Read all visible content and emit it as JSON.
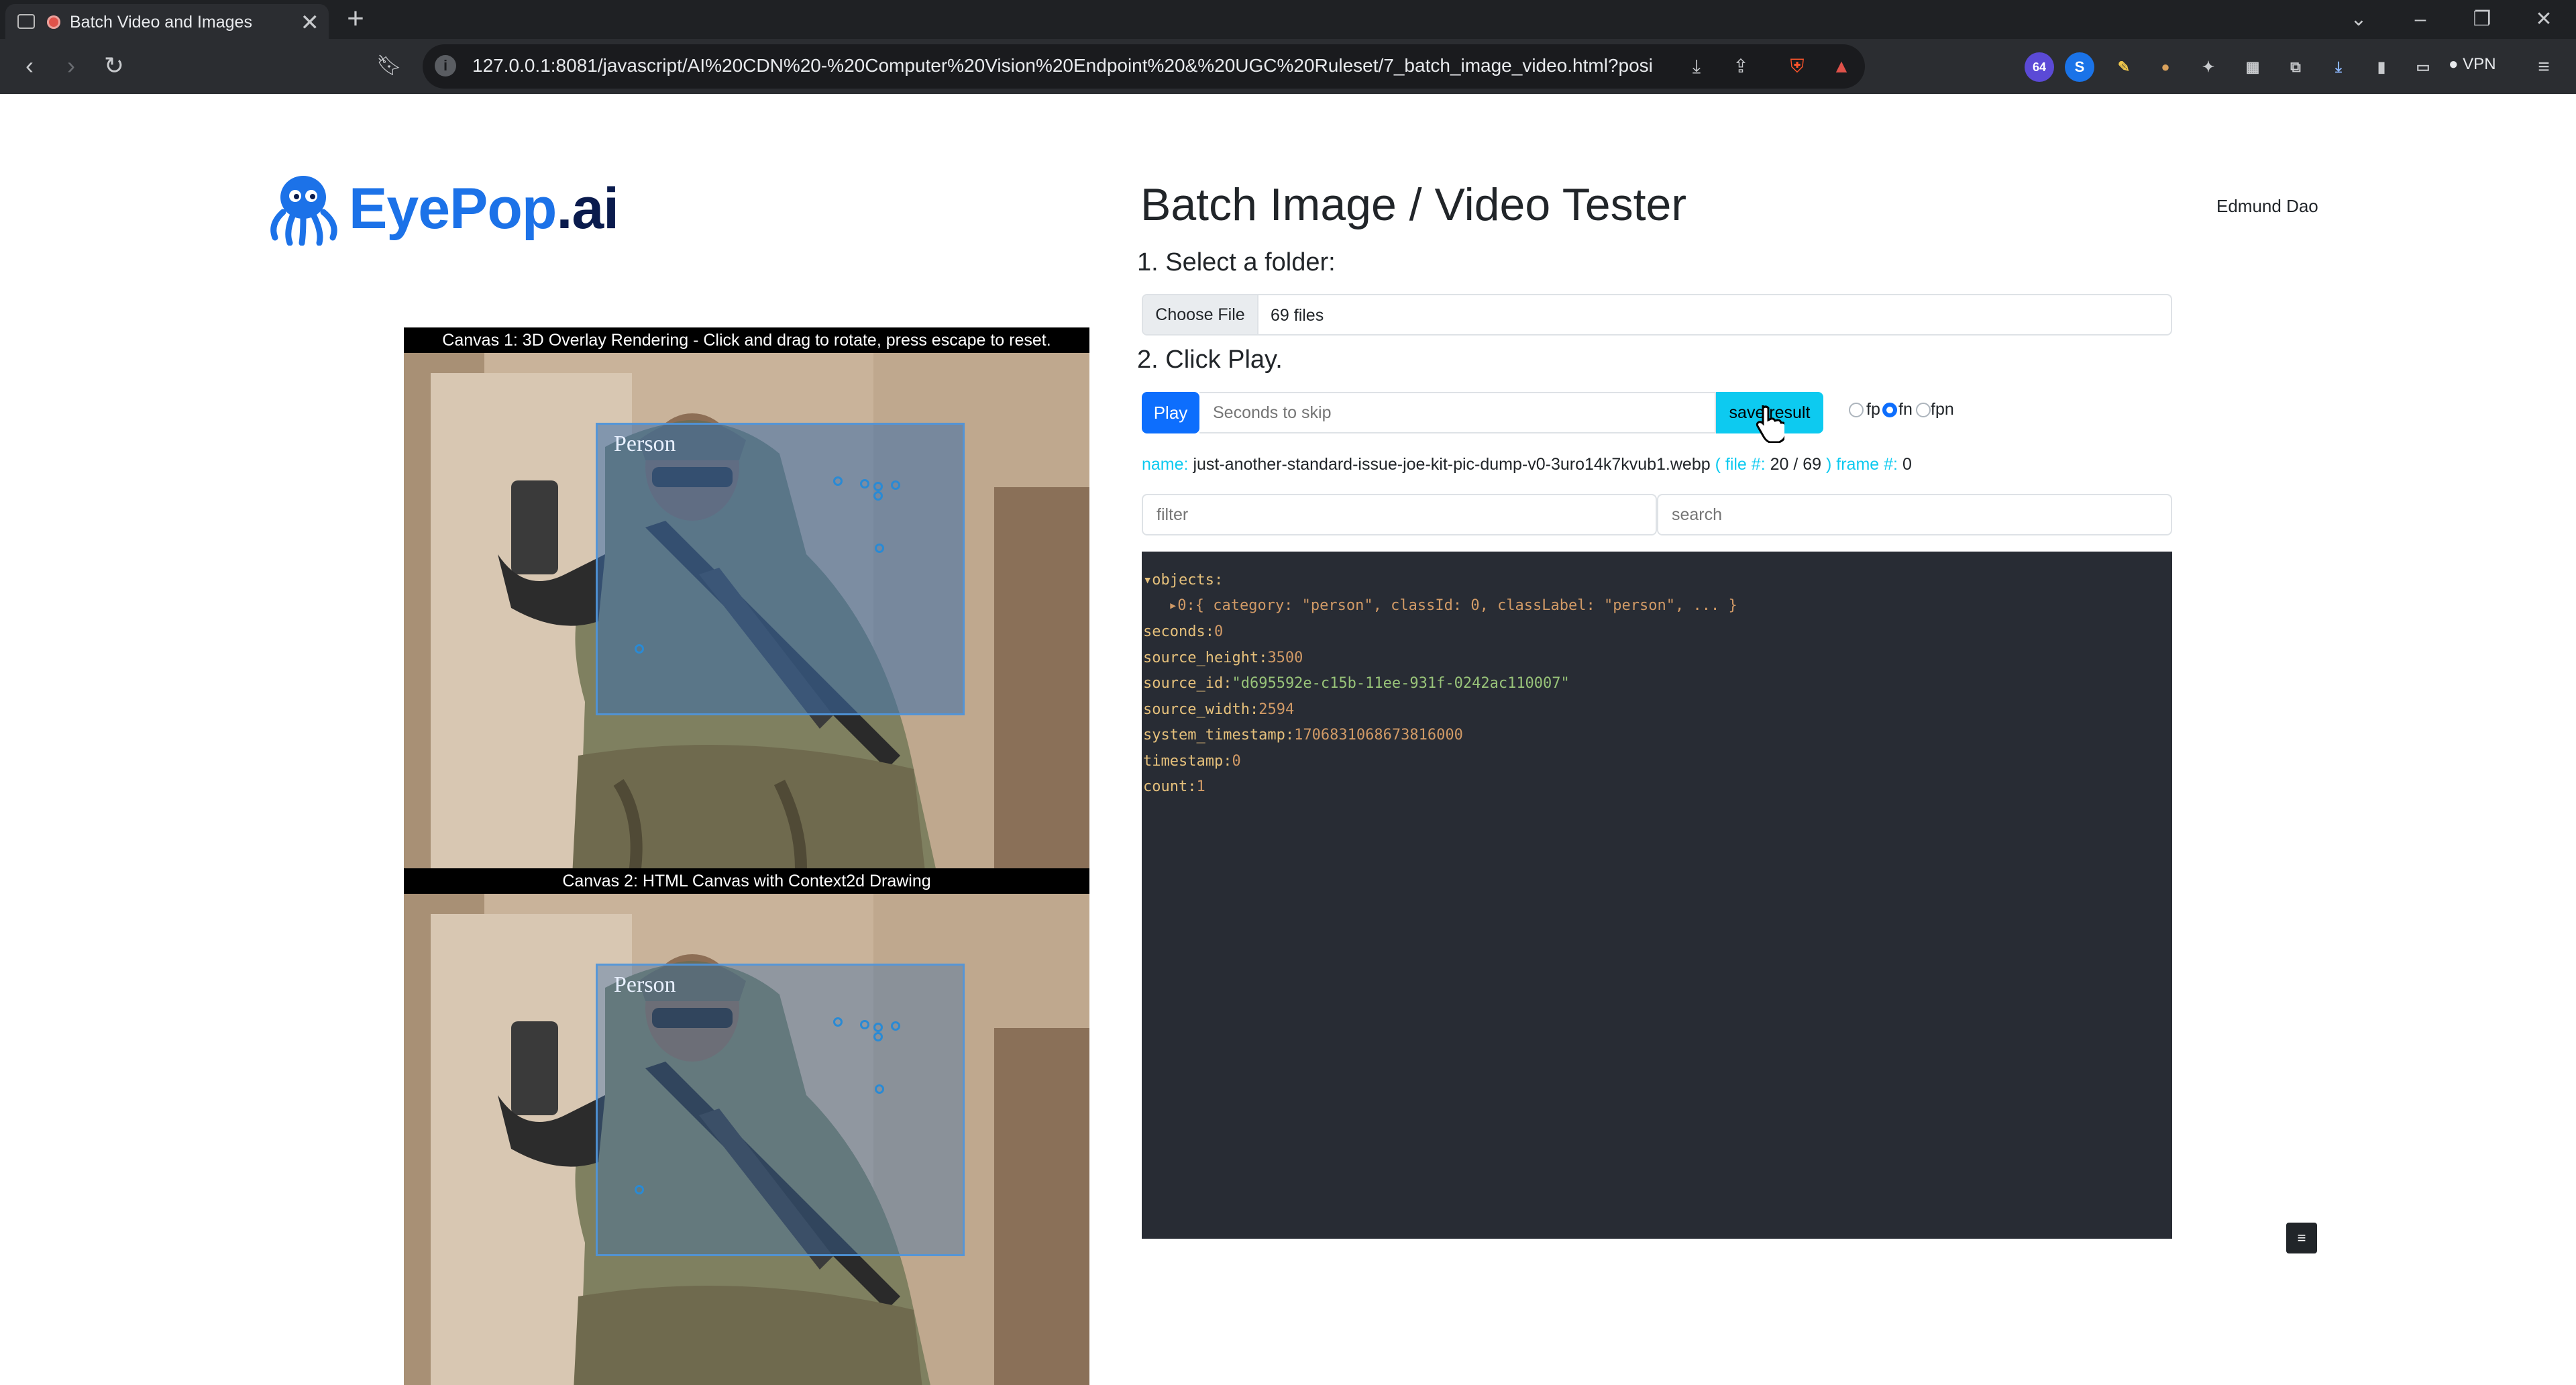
{
  "browser": {
    "tab_title": "Batch Video and Images",
    "tab_close": "✕",
    "new_tab": "+",
    "url": "127.0.0.1:8081/javascript/AI%20CDN%20-%20Computer%20Vision%20Endpoint%20&%20UGC%20Ruleset/7_batch_image_video.html?positiveN...",
    "vpn_label": "VPN",
    "ext_badge": "64"
  },
  "header": {
    "logo_main": "EyePop",
    "logo_suffix": ".ai",
    "title": "Batch Image / Video Tester",
    "user_name": "Edmund Dao"
  },
  "steps": {
    "step1": "1. Select a folder:",
    "step2": "2. Click Play."
  },
  "file_input": {
    "button_label": "Choose File",
    "value": "69 files"
  },
  "controls": {
    "play_label": "Play",
    "skip_placeholder": "Seconds to skip",
    "save_label": "save result",
    "radios": [
      {
        "label": "fp",
        "checked": false
      },
      {
        "label": "fn",
        "checked": true
      },
      {
        "label": "fpn",
        "checked": false
      }
    ]
  },
  "status": {
    "name_key": "name:",
    "name_value": "just-another-standard-issue-joe-kit-pic-dump-v0-3uro14k7kvub1.webp",
    "file_key": "( file #:",
    "file_value": "20 / 69",
    "frame_key": ") frame #:",
    "frame_value": "0"
  },
  "filter": {
    "placeholder": "filter"
  },
  "search": {
    "placeholder": "search"
  },
  "json_view": {
    "objects_key": "▾objects:",
    "object0": "▸0:{ category: \"person\", classId: 0, classLabel: \"person\", ... }",
    "rows": [
      {
        "key": "seconds",
        "value": "0",
        "type": "num"
      },
      {
        "key": "source_height",
        "value": "3500",
        "type": "num"
      },
      {
        "key": "source_id",
        "value": "\"d695592e-c15b-11ee-931f-0242ac110007\"",
        "type": "str"
      },
      {
        "key": "source_width",
        "value": "2594",
        "type": "num"
      },
      {
        "key": "system_timestamp",
        "value": "1706831068673816000",
        "type": "num"
      },
      {
        "key": "timestamp",
        "value": "0",
        "type": "num"
      },
      {
        "key": "count",
        "value": "1",
        "type": "num"
      }
    ]
  },
  "canvas1": {
    "caption": "Canvas 1: 3D Overlay Rendering - Click and drag to rotate, press escape to reset.",
    "box_label": "Person"
  },
  "canvas2": {
    "caption": "Canvas 2: HTML Canvas with Context2d Drawing",
    "box_label": "Person"
  },
  "corner_button": "≡",
  "colors": {
    "primary": "#0d6efd",
    "info": "#0dcaf0",
    "json_bg": "#282c34",
    "logo_blue": "#1c72e8"
  }
}
